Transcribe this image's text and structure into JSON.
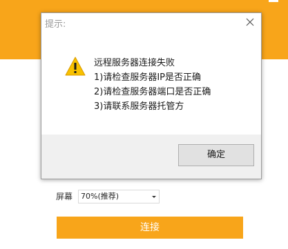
{
  "dialog": {
    "title": "提示:",
    "close_icon": "close-icon",
    "warning_icon": "warning-icon",
    "message_lines": [
      "远程服务器连接失败",
      "1)请检查服务器IP是否正确",
      "2)请检查服务器端口是否正确",
      "3)请联系服务器托管方"
    ],
    "ok_label": "确定"
  },
  "form": {
    "screen_label": "屏幕",
    "screen_value": "70%(推荐)",
    "connect_label": "连接"
  },
  "colors": {
    "accent": "#f8a51a",
    "warning": "#f8c100"
  }
}
